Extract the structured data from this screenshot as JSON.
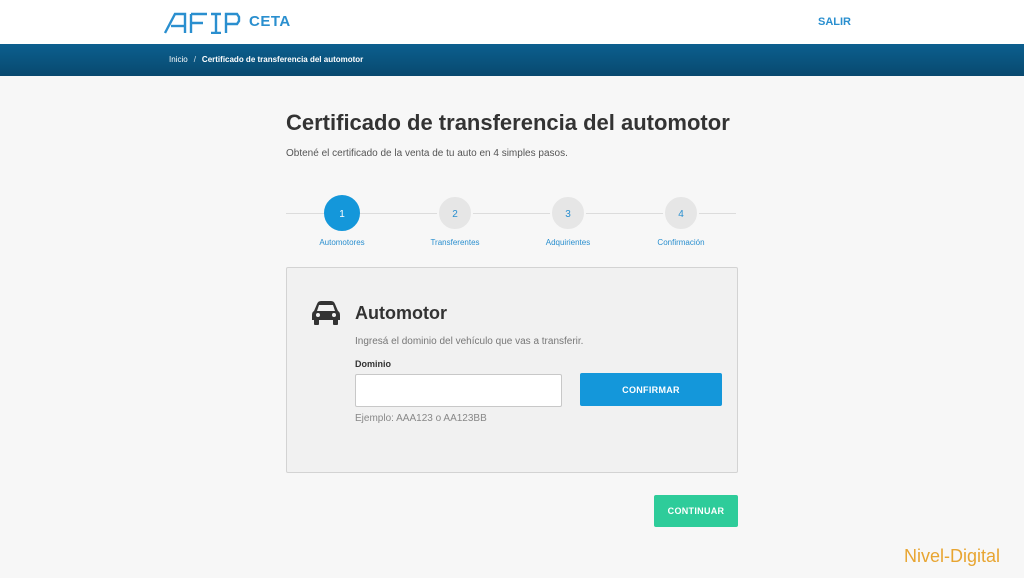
{
  "header": {
    "app_name": "CETA",
    "logo_text": "AFIP",
    "logout_label": "SALIR",
    "brand_color": "#2a8fcf"
  },
  "breadcrumb": {
    "items": [
      "Inicio",
      "Certificado de transferencia del automotor"
    ],
    "separator": "/"
  },
  "page": {
    "title": "Certificado de transferencia del automotor",
    "subtitle": "Obtené el certificado de la venta de tu auto en 4 simples pasos."
  },
  "stepper": {
    "active_step": 1,
    "steps": [
      {
        "number": "1",
        "label": "Automotores"
      },
      {
        "number": "2",
        "label": "Transferentes"
      },
      {
        "number": "3",
        "label": "Adquirientes"
      },
      {
        "number": "4",
        "label": "Confirmación"
      }
    ]
  },
  "form": {
    "icon": "car-icon",
    "title": "Automotor",
    "hint": "Ingresá el dominio del vehículo que vas a transferir.",
    "field_label": "Dominio",
    "field_value": "",
    "field_placeholder": "",
    "example": "Ejemplo: AAA123 o AA123BB",
    "confirm_label": "CONFIRMAR"
  },
  "actions": {
    "continue_label": "CONTINUAR",
    "continue_color": "#2ecc9a",
    "primary_color": "#1497da"
  },
  "watermark": "Nivel-Digital"
}
